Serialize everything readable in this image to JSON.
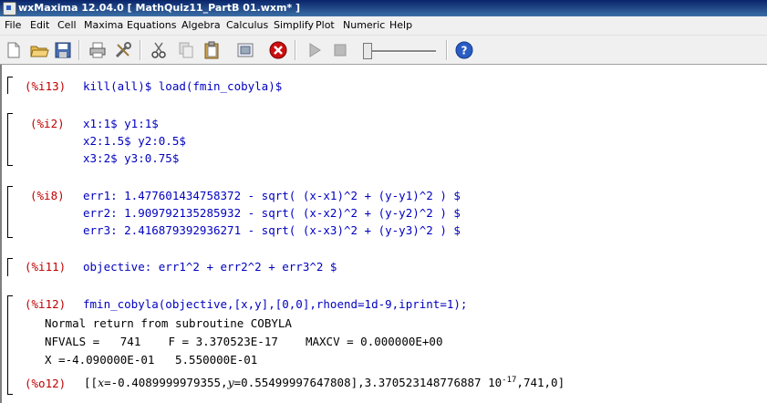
{
  "window": {
    "title": "wxMaxima 12.04.0  [ MathQuiz11_PartB 01.wxm* ]"
  },
  "menu": {
    "items": [
      "File",
      "Edit",
      "Cell",
      "Maxima",
      "Equations",
      "Algebra",
      "Calculus",
      "Simplify",
      "Plot",
      "Numeric",
      "Help"
    ]
  },
  "toolbar": {
    "icons": [
      "new-document-icon",
      "open-folder-icon",
      "save-icon",
      "print-icon",
      "preferences-icon",
      "cut-icon",
      "copy-icon",
      "paste-icon",
      "select-all-icon",
      "interrupt-icon",
      "play-icon",
      "stop-icon",
      "animation-slider",
      "help-icon"
    ],
    "colors": {
      "interrupt": "#cc1010",
      "help": "#2a5cc4"
    }
  },
  "cells": [
    {
      "label": "(%i13)",
      "lines": [
        "kill(all)$ load(fmin_cobyla)$"
      ]
    },
    {
      "label": "(%i2)",
      "lines": [
        "x1:1$ y1:1$",
        "x2:1.5$ y2:0.5$",
        "x3:2$ y3:0.75$"
      ]
    },
    {
      "label": "(%i8)",
      "lines": [
        "err1: 1.477601434758372 - sqrt( (x-x1)^2 + (y-y1)^2 ) $",
        "err2: 1.909792135285932 - sqrt( (x-x2)^2 + (y-y2)^2 ) $",
        "err3: 2.416879392936271 - sqrt( (x-x3)^2 + (y-y3)^2 ) $"
      ]
    },
    {
      "label": "(%i11)",
      "lines": [
        "objective: err1^2 + err2^2 + err3^2 $"
      ]
    },
    {
      "label": "(%i12)",
      "lines": [
        "fmin_cobyla(objective,[x,y],[0,0],rhoend=1d-9,iprint=1);"
      ]
    }
  ],
  "output": {
    "lines": [
      "Normal return from subroutine COBYLA",
      "NFVALS =   741    F = 3.370523E-17    MAXCV = 0.000000E+00",
      "X =-4.090000E-01   5.550000E-01"
    ],
    "result_label": "(%o12)",
    "result": {
      "open": "[[",
      "x_var": "x",
      "x_val": "=-0.4089999979355,",
      "y_var": "y",
      "y_val": "=0.55499997647808],3.370523148776887 10",
      "exp": "-17",
      "tail": ",741,0]"
    }
  },
  "colors": {
    "input_text": "#0000c0",
    "label": "#c00000",
    "output_text": "#000000"
  }
}
